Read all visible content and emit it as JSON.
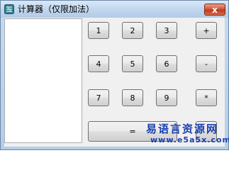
{
  "window": {
    "title": "计算器（仅限加法）",
    "close_label": "x",
    "app_icon": "calculator-app-icon"
  },
  "keypad": {
    "digits": [
      "1",
      "2",
      "3",
      "4",
      "5",
      "6",
      "7",
      "8",
      "9"
    ],
    "operators": [
      "+",
      "-",
      "*"
    ],
    "equals_label": "="
  },
  "watermark": {
    "line1": "易语言资源网",
    "line2": "www.e5a5x.com"
  },
  "colors": {
    "titlebar": "#c2d7ee",
    "close_button": "#c0391c",
    "client_background": "#f0f0f0",
    "watermark": "#1a3fae"
  }
}
